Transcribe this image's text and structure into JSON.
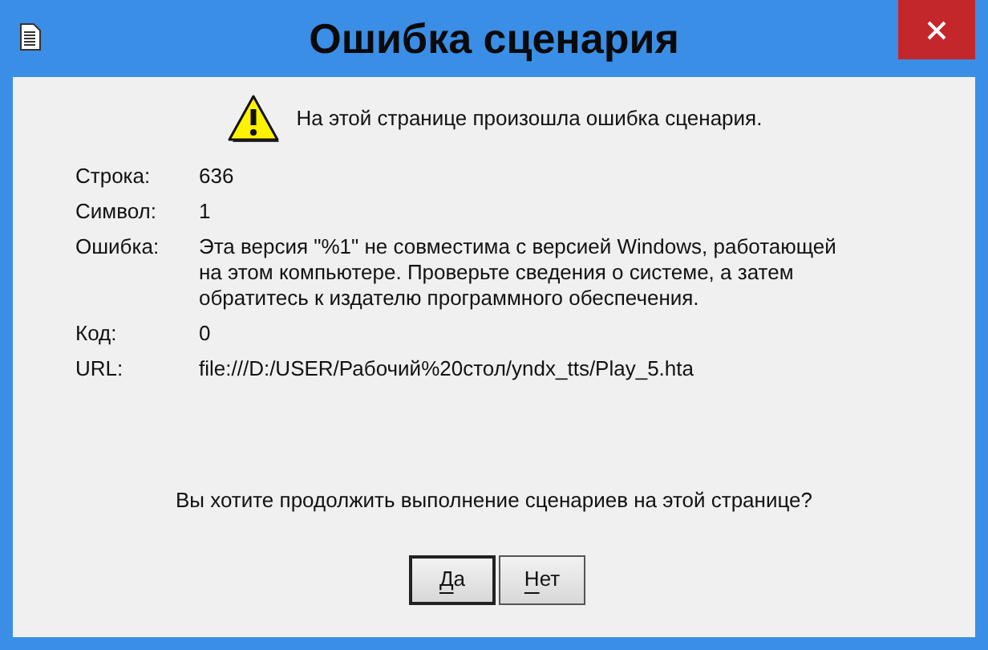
{
  "window": {
    "title": "Ошибка сценария"
  },
  "message": "На этой странице произошла ошибка сценария.",
  "details": [
    {
      "label": "Строка:",
      "value": "636"
    },
    {
      "label": "Символ:",
      "value": "1"
    },
    {
      "label": "Ошибка:",
      "value": "Эта версия \"%1\" не совместима с версией Windows, работающей на этом компьютере. Проверьте сведения о системе, а затем обратитесь к издателю программного обеспечения."
    },
    {
      "label": "Код:",
      "value": "0"
    },
    {
      "label": "URL:",
      "value": "file:///D:/USER/Рабочий%20стол/yndx_tts/Play_5.hta"
    }
  ],
  "question": "Вы хотите продолжить выполнение сценариев на этой странице?",
  "buttons": [
    {
      "label": "Да",
      "default": true,
      "mnemonic": true
    },
    {
      "label": "Нет",
      "default": false,
      "mnemonic": true
    }
  ]
}
